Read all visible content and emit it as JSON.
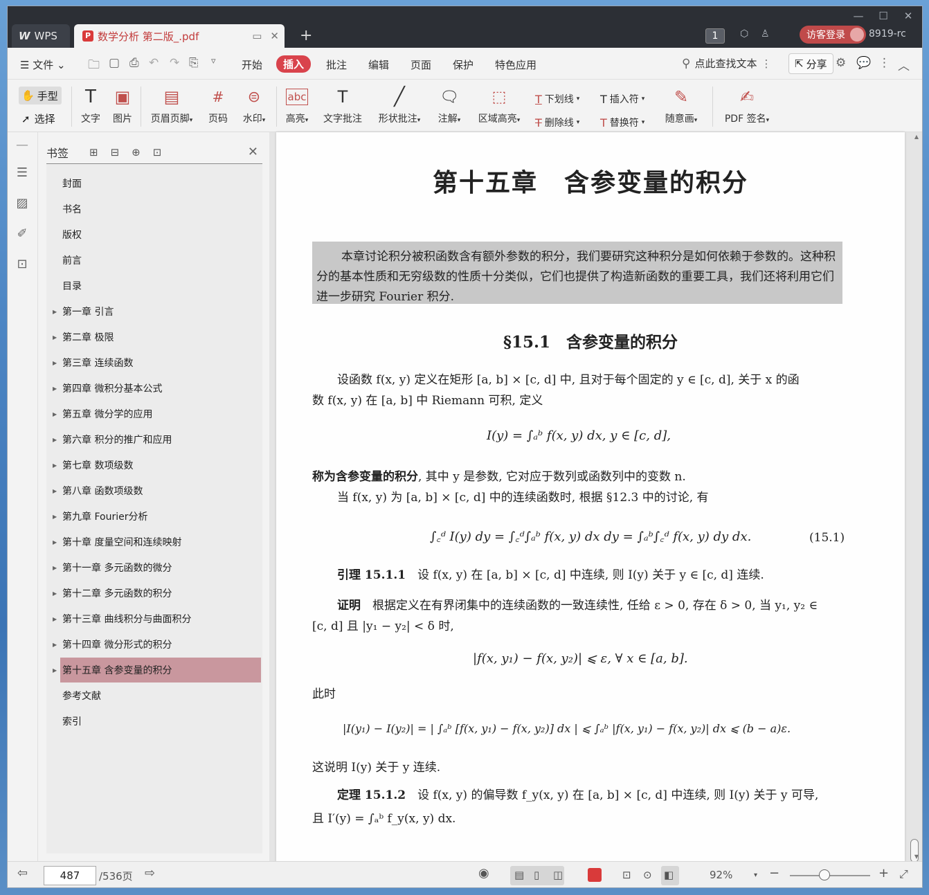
{
  "window": {
    "minimize": "—",
    "maximize": "☐",
    "close": "✕"
  },
  "tabs": {
    "wps": "WPS",
    "doc": "数学分析 第二版_.pdf",
    "new_tab": "+"
  },
  "titlebar": {
    "badge": "1",
    "visitor_login": "访客登录",
    "user": "8919-rc"
  },
  "menu": {
    "file": "文件",
    "start": "开始",
    "insert": "插入",
    "comment": "批注",
    "edit": "编辑",
    "page": "页面",
    "protect": "保护",
    "special": "特色应用",
    "search": "点此查找文本",
    "share": "分享"
  },
  "ribbon": {
    "hand": "手型",
    "select": "选择",
    "text": "文字",
    "image": "图片",
    "header_footer": "页眉页脚",
    "page_num": "页码",
    "watermark": "水印",
    "highlight": "高亮",
    "text_comment": "文字批注",
    "shape_comment": "形状批注",
    "annotation": "注解",
    "area_highlight": "区域高亮",
    "underline": "下划线",
    "strikethrough": "删除线",
    "insert_mark": "插入符",
    "replace_mark": "替换符",
    "freehand": "随意画",
    "pdf_sign": "PDF 签名",
    "highlight_sample": "abc"
  },
  "bookmarks": {
    "title": "书签",
    "items": [
      {
        "label": "封面",
        "expandable": false
      },
      {
        "label": "书名",
        "expandable": false
      },
      {
        "label": "版权",
        "expandable": false
      },
      {
        "label": "前言",
        "expandable": false
      },
      {
        "label": "目录",
        "expandable": false
      },
      {
        "label": "第一章 引言",
        "expandable": true
      },
      {
        "label": "第二章 极限",
        "expandable": true
      },
      {
        "label": "第三章 连续函数",
        "expandable": true
      },
      {
        "label": "第四章 微积分基本公式",
        "expandable": true
      },
      {
        "label": "第五章 微分学的应用",
        "expandable": true
      },
      {
        "label": "第六章 积分的推广和应用",
        "expandable": true
      },
      {
        "label": "第七章 数项级数",
        "expandable": true
      },
      {
        "label": "第八章 函数项级数",
        "expandable": true
      },
      {
        "label": "第九章 Fourier分析",
        "expandable": true
      },
      {
        "label": "第十章 度量空间和连续映射",
        "expandable": true
      },
      {
        "label": "第十一章 多元函数的微分",
        "expandable": true
      },
      {
        "label": "第十二章 多元函数的积分",
        "expandable": true
      },
      {
        "label": "第十三章 曲线积分与曲面积分",
        "expandable": true
      },
      {
        "label": "第十四章 微分形式的积分",
        "expandable": true
      },
      {
        "label": "第十五章 含参变量的积分",
        "expandable": true,
        "selected": true
      },
      {
        "label": "参考文献",
        "expandable": false
      },
      {
        "label": "索引",
        "expandable": false
      }
    ]
  },
  "document": {
    "chapter_title": "第十五章　含参变量的积分",
    "abstract": "本章讨论积分被积函数含有额外参数的积分，我们要研究这种积分是如何依赖于参数的。这种积分的基本性质和无穷级数的性质十分类似，它们也提供了构造新函数的重要工具，我们还将利用它们进一步研究 Fourier 积分.",
    "section_title": "§15.1　含参变量的积分",
    "p1a": "设函数 f(x, y) 定义在矩形 [a, b] × [c, d] 中, 且对于每个固定的 y ∈ [c, d], 关于 x 的函",
    "p1b": "数 f(x, y) 在 [a, b] 中 Riemann 可积, 定义",
    "eq1": "I(y) = ∫ₐᵇ f(x, y) dx,    y ∈ [c, d],",
    "p2_bold": "称为含参变量的积分",
    "p2_rest": ", 其中 y 是参数, 它对应于数列或函数列中的变数 n.",
    "p3": "当 f(x, y) 为 [a, b] × [c, d] 中的连续函数时, 根据 §12.3 中的讨论, 有",
    "eq2": "∫꜀ᵈ I(y) dy = ∫꜀ᵈ∫ₐᵇ f(x, y) dx dy = ∫ₐᵇ∫꜀ᵈ f(x, y) dy dx.",
    "eq2_num": "(15.1)",
    "lemma_label": "引理 15.1.1",
    "lemma_text": "设 f(x, y) 在 [a, b] × [c, d] 中连续, 则 I(y) 关于 y ∈ [c, d] 连续.",
    "proof_label": "证明",
    "proof_a": "根据定义在有界闭集中的连续函数的一致连续性, 任给 ε > 0, 存在 δ > 0, 当 y₁, y₂ ∈",
    "proof_b": "[c, d] 且 |y₁ − y₂| < δ 时,",
    "eq3": "|f(x, y₁) − f(x, y₂)| ⩽ ε,   ∀ x ∈ [a, b].",
    "p_then": "此时",
    "eq4": "|I(y₁) − I(y₂)| = | ∫ₐᵇ [f(x, y₁) − f(x, y₂)] dx | ⩽ ∫ₐᵇ |f(x, y₁) − f(x, y₂)| dx ⩽ (b − a)ε.",
    "p_cont": "这说明 I(y) 关于 y 连续.",
    "thm_label": "定理 15.1.2",
    "thm_a": "设 f(x, y) 的偏导数 f_y(x, y) 在 [a, b] × [c, d] 中连续, 则 I(y) 关于 y 可导,",
    "thm_b": "且 I′(y) = ∫ₐᵇ f_y(x, y) dx."
  },
  "status": {
    "current_page": "487",
    "total_pages": "/536页",
    "zoom": "92%"
  },
  "colors": {
    "accent": "#d9434c",
    "titlebar": "#2c2f35",
    "selected_bookmark": "#c9979e",
    "visitor": "#c04a4a"
  }
}
